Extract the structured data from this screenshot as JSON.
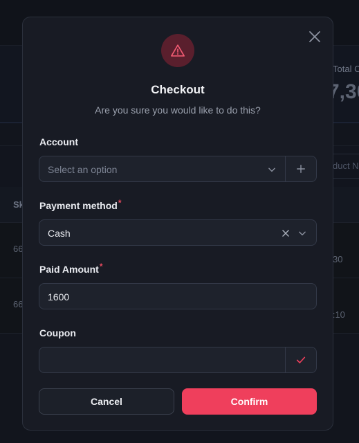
{
  "background": {
    "stat_label": "Total C",
    "stat_value": "7,30",
    "filter_placeholder": "duct N",
    "table_header_sku": "Sk",
    "rows": [
      {
        "sku": "66",
        "right": "30"
      },
      {
        "sku": "66",
        "right": "nt:10"
      }
    ]
  },
  "modal": {
    "title": "Checkout",
    "subtitle": "Are you sure you would like to do this?",
    "account": {
      "label": "Account",
      "placeholder": "Select an option"
    },
    "payment_method": {
      "label": "Payment method",
      "required_mark": "*",
      "value": "Cash"
    },
    "paid_amount": {
      "label": "Paid Amount",
      "required_mark": "*",
      "value": "1600"
    },
    "coupon": {
      "label": "Coupon",
      "value": ""
    },
    "cancel_label": "Cancel",
    "confirm_label": "Confirm"
  },
  "colors": {
    "accent": "#ef3f5c",
    "warning_bg": "#5a1f2d",
    "modal_bg": "#181b24",
    "field_bg": "#1e222c"
  },
  "icons": [
    "close-icon",
    "warning-icon",
    "chevron-down-icon",
    "plus-icon",
    "clear-icon",
    "check-icon"
  ]
}
